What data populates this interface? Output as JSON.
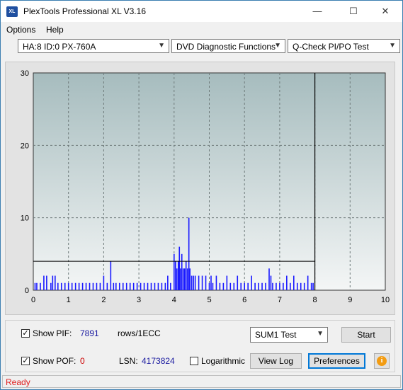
{
  "window": {
    "title": "PlexTools Professional XL V3.16",
    "icon_text": "XL",
    "controls": [
      "minimize",
      "maximize",
      "close"
    ]
  },
  "menu": [
    {
      "label": "Options",
      "accel": "O"
    },
    {
      "label": "Help",
      "accel": "H"
    }
  ],
  "toolbar": {
    "drive": "HA:8 ID:0  PX-760A",
    "function": "DVD Diagnostic Functions",
    "test": "Q-Check PI/PO Test"
  },
  "chart_data": {
    "type": "bar",
    "xlim": [
      0,
      10
    ],
    "ylim": [
      0,
      30
    ],
    "x_ticks": [
      0,
      1,
      2,
      3,
      4,
      5,
      6,
      7,
      8,
      9,
      10
    ],
    "y_ticks": [
      0,
      10,
      20,
      30
    ],
    "threshold_line": 4,
    "end_marker_x": 8,
    "grid": true,
    "colors": {
      "plot_bg_top": "#a6bcbe",
      "plot_bg_bottom": "#f4f6f6",
      "bars": "#1a1aff",
      "grid": "#6e7a7a"
    },
    "series": [
      {
        "values_note": "PI errors per position (GB)",
        "points": [
          [
            0.05,
            1
          ],
          [
            0.1,
            1
          ],
          [
            0.2,
            1
          ],
          [
            0.3,
            2
          ],
          [
            0.38,
            2
          ],
          [
            0.5,
            1
          ],
          [
            0.55,
            2
          ],
          [
            0.62,
            2
          ],
          [
            0.7,
            1
          ],
          [
            0.8,
            1
          ],
          [
            0.9,
            1
          ],
          [
            1.0,
            1
          ],
          [
            1.1,
            1
          ],
          [
            1.2,
            1
          ],
          [
            1.3,
            1
          ],
          [
            1.4,
            1
          ],
          [
            1.5,
            1
          ],
          [
            1.6,
            1
          ],
          [
            1.7,
            1
          ],
          [
            1.8,
            1
          ],
          [
            1.9,
            1
          ],
          [
            2.0,
            2
          ],
          [
            2.1,
            1
          ],
          [
            2.2,
            4
          ],
          [
            2.28,
            1
          ],
          [
            2.35,
            1
          ],
          [
            2.45,
            1
          ],
          [
            2.55,
            1
          ],
          [
            2.65,
            1
          ],
          [
            2.75,
            1
          ],
          [
            2.85,
            1
          ],
          [
            2.95,
            1
          ],
          [
            3.05,
            1
          ],
          [
            3.15,
            1
          ],
          [
            3.25,
            1
          ],
          [
            3.35,
            1
          ],
          [
            3.45,
            1
          ],
          [
            3.55,
            1
          ],
          [
            3.65,
            1
          ],
          [
            3.75,
            1
          ],
          [
            3.82,
            2
          ],
          [
            3.9,
            1
          ],
          [
            4.0,
            5
          ],
          [
            4.04,
            4
          ],
          [
            4.08,
            3
          ],
          [
            4.12,
            4
          ],
          [
            4.15,
            6
          ],
          [
            4.18,
            3
          ],
          [
            4.22,
            5
          ],
          [
            4.26,
            3
          ],
          [
            4.3,
            3
          ],
          [
            4.34,
            4
          ],
          [
            4.38,
            3
          ],
          [
            4.42,
            10
          ],
          [
            4.45,
            3
          ],
          [
            4.5,
            2
          ],
          [
            4.55,
            2
          ],
          [
            4.6,
            2
          ],
          [
            4.7,
            2
          ],
          [
            4.8,
            2
          ],
          [
            4.9,
            2
          ],
          [
            5.0,
            1
          ],
          [
            5.05,
            2
          ],
          [
            5.1,
            1
          ],
          [
            5.2,
            2
          ],
          [
            5.3,
            1
          ],
          [
            5.4,
            1
          ],
          [
            5.5,
            2
          ],
          [
            5.6,
            1
          ],
          [
            5.7,
            1
          ],
          [
            5.8,
            2
          ],
          [
            5.9,
            1
          ],
          [
            6.0,
            1
          ],
          [
            6.1,
            1
          ],
          [
            6.2,
            2
          ],
          [
            6.3,
            1
          ],
          [
            6.4,
            1
          ],
          [
            6.5,
            1
          ],
          [
            6.6,
            1
          ],
          [
            6.7,
            3
          ],
          [
            6.75,
            2
          ],
          [
            6.8,
            1
          ],
          [
            6.9,
            1
          ],
          [
            7.0,
            1
          ],
          [
            7.1,
            1
          ],
          [
            7.2,
            2
          ],
          [
            7.3,
            1
          ],
          [
            7.4,
            2
          ],
          [
            7.5,
            1
          ],
          [
            7.6,
            1
          ],
          [
            7.7,
            1
          ],
          [
            7.8,
            2
          ],
          [
            7.9,
            1
          ],
          [
            7.95,
            1
          ]
        ]
      }
    ]
  },
  "controls": {
    "show_pif_label": "Show PIF:",
    "show_pif_checked": true,
    "pif_value": "7891",
    "pif_units": "rows/1ECC",
    "show_pof_label": "Show POF:",
    "show_pof_checked": true,
    "pof_value": "0",
    "lsn_label": "LSN:",
    "lsn_value": "4173824",
    "logarithmic_label": "Logarithmic",
    "logarithmic_checked": false,
    "test_select": "SUM1 Test",
    "start_label": "Start",
    "view_log_label": "View Log",
    "preferences_label": "Preferences",
    "info_glyph": "i"
  },
  "status": {
    "text": "Ready",
    "color": "#e02020"
  }
}
